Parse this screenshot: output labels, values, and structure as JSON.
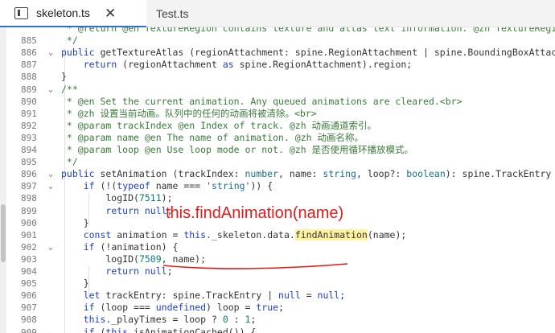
{
  "tabs": [
    {
      "label": "skeleton.ts",
      "active": true,
      "close": "✕"
    },
    {
      "label": "Test.ts",
      "active": false
    }
  ],
  "lines": [
    {
      "n": "",
      "text": " * @return @en TextureRegion contains texture and atlas text information. @zh TextureRegion包含纹理和图集文本信息"
    },
    {
      "n": "885",
      "text": " */"
    },
    {
      "n": "886",
      "text": "public getTextureAtlas (regionAttachment: spine.RegionAttachment | spine.BoundingBoxAttachment): spine.TextureRe"
    },
    {
      "n": "887",
      "text": "    return (regionAttachment as spine.RegionAttachment).region;"
    },
    {
      "n": "888",
      "text": "}"
    },
    {
      "n": "889",
      "text": "/**"
    },
    {
      "n": "890",
      "text": " * @en Set the current animation. Any queued animations are cleared.<br>"
    },
    {
      "n": "891",
      "text": " * @zh 设置当前动画。队列中的任何的动画将被清除。<br>"
    },
    {
      "n": "892",
      "text": " * @param trackIndex @en Index of track. @zh 动画通道索引。"
    },
    {
      "n": "893",
      "text": " * @param name @en The name of animation. @zh 动画名称。"
    },
    {
      "n": "894",
      "text": " * @param loop @en Use loop mode or not. @zh 是否使用循环播放模式。"
    },
    {
      "n": "895",
      "text": " */"
    },
    {
      "n": "896",
      "text": "public setAnimation (trackIndex: number, name: string, loop?: boolean): spine.TrackEntry | null {"
    },
    {
      "n": "897",
      "text": "    if (!(typeof name === 'string')) {"
    },
    {
      "n": "898",
      "text": "        logID(7511);"
    },
    {
      "n": "899",
      "text": "        return null;"
    },
    {
      "n": "900",
      "text": "    }"
    },
    {
      "n": "901",
      "text": "    const animation = this._skeleton.data.findAnimation(name);"
    },
    {
      "n": "902",
      "text": "    if (!animation) {"
    },
    {
      "n": "903",
      "text": "        logID(7509, name);"
    },
    {
      "n": "904",
      "text": "        return null;"
    },
    {
      "n": "905",
      "text": "    }"
    },
    {
      "n": "906",
      "text": "    let trackEntry: spine.TrackEntry | null = null;"
    },
    {
      "n": "907",
      "text": "    if (loop === undefined) loop = true;"
    },
    {
      "n": "908",
      "text": "    this._playTimes = loop ? 0 : 1;"
    },
    {
      "n": "909",
      "text": "    if (this.isAnimationCached()) {"
    }
  ],
  "folds": {
    "886": "⌄",
    "889": "⌄",
    "896": "⌄",
    "897": "⌄",
    "902": "⌄",
    "909": "⌄"
  },
  "annotation": "this.findAnimation(name)",
  "colors": {
    "accent": "#2f6fd6",
    "annotation": "#e01b1b",
    "highlight": "#fff3a0"
  }
}
